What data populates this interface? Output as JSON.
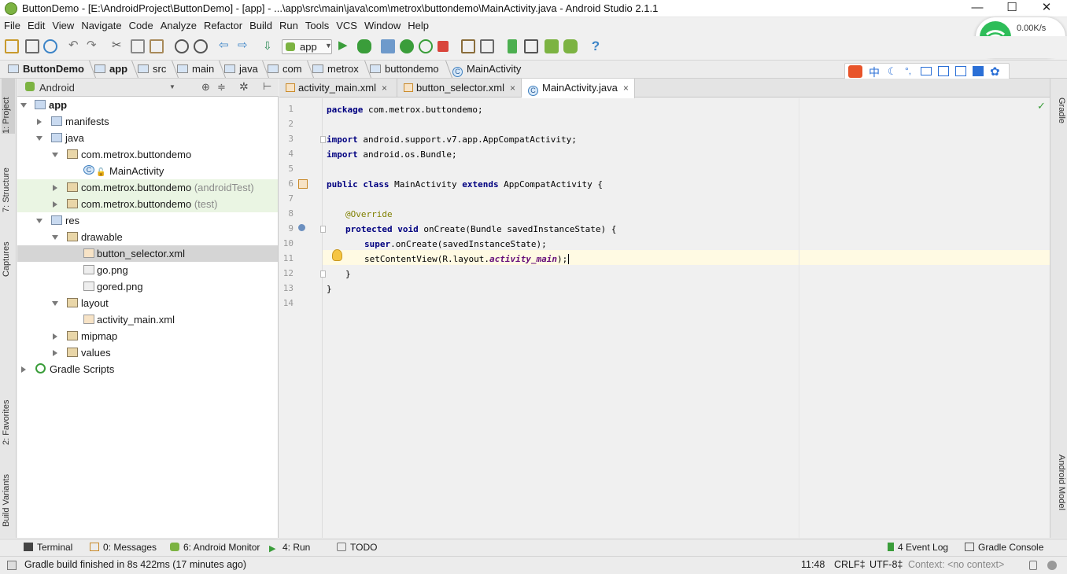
{
  "window": {
    "title": "ButtonDemo - [E:\\AndroidProject\\ButtonDemo] - [app] - ...\\app\\src\\main\\java\\com\\metrox\\buttondemo\\MainActivity.java - Android Studio 2.1.1",
    "minimize": "—",
    "maximize": "☐",
    "close": "✕"
  },
  "menu": [
    "File",
    "Edit",
    "View",
    "Navigate",
    "Code",
    "Analyze",
    "Refactor",
    "Build",
    "Run",
    "Tools",
    "VCS",
    "Window",
    "Help"
  ],
  "toolbar": {
    "run_config": "app",
    "help": "?"
  },
  "breadcrumb": [
    "ButtonDemo",
    "app",
    "src",
    "main",
    "java",
    "com",
    "metrox",
    "buttondemo",
    "MainActivity"
  ],
  "network_widget": {
    "speed": "0.00K/s",
    "count": "2"
  },
  "ime_bar": {
    "lang": "中"
  },
  "left_tool_tabs": [
    "1: Project",
    "7: Structure",
    "Captures",
    "2: Favorites",
    "Build Variants"
  ],
  "right_tool_tabs": [
    "Gradle",
    "Android Model"
  ],
  "project_pane": {
    "view": "Android",
    "tree": [
      {
        "label": "app",
        "extra": ""
      },
      {
        "label": "manifests",
        "extra": ""
      },
      {
        "label": "java",
        "extra": ""
      },
      {
        "label": "com.metrox.buttondemo",
        "extra": ""
      },
      {
        "label": "MainActivity",
        "extra": ""
      },
      {
        "label": "com.metrox.buttondemo",
        "extra": "(androidTest)"
      },
      {
        "label": "com.metrox.buttondemo",
        "extra": "(test)"
      },
      {
        "label": "res",
        "extra": ""
      },
      {
        "label": "drawable",
        "extra": ""
      },
      {
        "label": "button_selector.xml",
        "extra": ""
      },
      {
        "label": "go.png",
        "extra": ""
      },
      {
        "label": "gored.png",
        "extra": ""
      },
      {
        "label": "layout",
        "extra": ""
      },
      {
        "label": "activity_main.xml",
        "extra": ""
      },
      {
        "label": "mipmap",
        "extra": ""
      },
      {
        "label": "values",
        "extra": ""
      },
      {
        "label": "Gradle Scripts",
        "extra": ""
      }
    ]
  },
  "editor": {
    "tabs": [
      {
        "label": "activity_main.xml",
        "close": "×"
      },
      {
        "label": "button_selector.xml",
        "close": "×"
      },
      {
        "label": "MainActivity.java",
        "close": "×"
      }
    ],
    "line_numbers": [
      "1",
      "2",
      "3",
      "4",
      "5",
      "6",
      "7",
      "8",
      "9",
      "10",
      "11",
      "12",
      "13",
      "14"
    ],
    "code": {
      "l1a": "package",
      "l1b": " com.metrox.buttondemo;",
      "l3a": "import",
      "l3b": " android.support.v7.app.AppCompatActivity;",
      "l4a": "import",
      "l4b": " android.os.Bundle;",
      "l6a": "public class",
      "l6b": " MainActivity ",
      "l6c": "extends",
      "l6d": " AppCompatActivity {",
      "l8": "@Override",
      "l9a": "protected void",
      "l9b": " onCreate(Bundle savedInstanceState) {",
      "l10a": "super",
      "l10b": ".onCreate(savedInstanceState);",
      "l11a": "setContentView(R.layout.",
      "l11b": "activity_main",
      "l11c": ");",
      "l12": "}",
      "l13": "}"
    }
  },
  "bottom_tabs": {
    "terminal": "Terminal",
    "messages": "0: Messages",
    "monitor": "6: Android Monitor",
    "run": "4: Run",
    "todo": "TODO",
    "event_log": "4 Event Log",
    "gradle_console": "Gradle Console"
  },
  "status": {
    "message": "Gradle build finished in 8s 422ms (17 minutes ago)",
    "position": "11:48",
    "line_sep": "CRLF‡",
    "encoding": "UTF-8‡",
    "context": "Context: <no context>"
  }
}
